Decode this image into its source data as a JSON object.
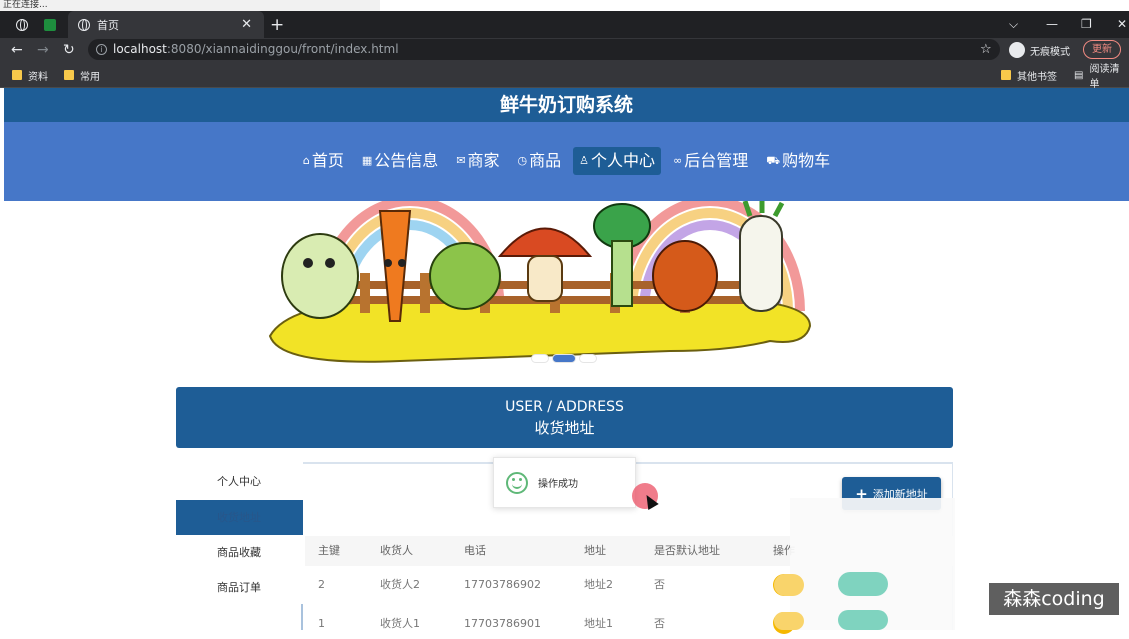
{
  "browser": {
    "loading_text": "正在连接...",
    "tab_title": "首页",
    "new_tab": "+",
    "address": {
      "host": "localhost",
      "rest": ":8080/xiannaidinggou/front/index.html"
    },
    "incognito_label": "无痕模式",
    "update_label": "更新",
    "bookmarks": [
      "资料",
      "常用"
    ],
    "bookmarks_right": [
      "其他书签",
      "阅读清单"
    ]
  },
  "site": {
    "title": "鲜牛奶订购系统",
    "nav": [
      {
        "label": "首页",
        "icon": "home-icon",
        "glyph": "⌂"
      },
      {
        "label": "公告信息",
        "icon": "calendar-icon",
        "glyph": "▦"
      },
      {
        "label": "商家",
        "icon": "mail-icon",
        "glyph": "✉"
      },
      {
        "label": "商品",
        "icon": "clock-icon",
        "glyph": "◷"
      },
      {
        "label": "个人中心",
        "icon": "user-icon",
        "glyph": "♙"
      },
      {
        "label": "后台管理",
        "icon": "link-icon",
        "glyph": "∞"
      },
      {
        "label": "购物车",
        "icon": "cart-icon",
        "glyph": "⛟"
      }
    ],
    "active_nav": "个人中心"
  },
  "section": {
    "title_en": "USER / ADDRESS",
    "title_cn": "收货地址"
  },
  "side_menu": [
    "个人中心",
    "收货地址",
    "商品收藏",
    "商品订单"
  ],
  "add_button": "添加新地址",
  "table": {
    "headers": [
      "主键",
      "收货人",
      "电话",
      "地址",
      "是否默认地址",
      "操作"
    ],
    "rows": [
      [
        "2",
        "收货人2",
        "17703786902",
        "地址2",
        "否"
      ],
      [
        "1",
        "收货人1",
        "17703786901",
        "地址1",
        "否"
      ]
    ]
  },
  "toast": "操作成功",
  "watermark": "森森coding",
  "colors": {
    "primary": "#1e5d96",
    "nav": "#4677c8",
    "edit": "#f5b800",
    "delete": "#3bb8a0"
  }
}
